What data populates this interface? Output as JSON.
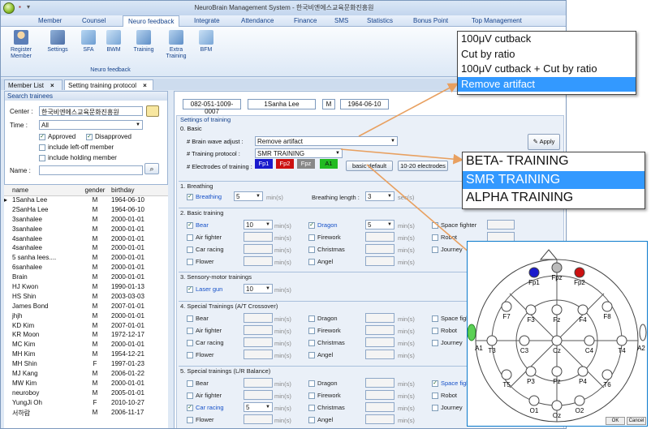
{
  "window": {
    "title": "NeuroBrain Management System - 한국비엔에스교육문화진흥원"
  },
  "menu": [
    "Member",
    "Counsel",
    "Neuro feedback",
    "Integrate",
    "Attendance",
    "Finance",
    "SMS",
    "Statistics",
    "Bonus Point",
    "Top Management"
  ],
  "ribbon": {
    "buttons": [
      "Register Member",
      "Settings",
      "SFA",
      "BWM",
      "Training",
      "Extra Training",
      "BFM"
    ],
    "group_label": "Neuro feedback"
  },
  "tabs": [
    {
      "label": "Member List"
    },
    {
      "label": "Setting training protocol"
    }
  ],
  "search": {
    "header": "Search trainees",
    "center_label": "Center :",
    "center_value": "한국비엔에스교육문화진흥원",
    "time_label": "Time :",
    "time_value": "All",
    "approved": "Approved",
    "disapproved": "Disapproved",
    "left_off": "include left-off member",
    "holding": "include holding member",
    "name_label": "Name :",
    "name_value": ""
  },
  "member_table": {
    "headers": [
      "name",
      "gender",
      "birthday"
    ],
    "rows": [
      [
        "1Sanha Lee",
        "M",
        "1964-06-10"
      ],
      [
        "2SanHa Lee",
        "M",
        "1964-06-10"
      ],
      [
        "3sanhalee",
        "M",
        "2000-01-01"
      ],
      [
        "3sanhalee",
        "M",
        "2000-01-01"
      ],
      [
        "4sanhalee",
        "M",
        "2000-01-01"
      ],
      [
        "4sanhalee",
        "M",
        "2000-01-01"
      ],
      [
        "5 sanha lees....",
        "M",
        "2000-01-01"
      ],
      [
        "6sanhalee",
        "M",
        "2000-01-01"
      ],
      [
        "Brain",
        "M",
        "2000-01-01"
      ],
      [
        "HJ Kwon",
        "M",
        "1990-01-13"
      ],
      [
        "HS Shin",
        "M",
        "2003-03-03"
      ],
      [
        "James Bond",
        "M",
        "2007-01-01"
      ],
      [
        "jhjh",
        "M",
        "2000-01-01"
      ],
      [
        "KD Kim",
        "M",
        "2007-01-01"
      ],
      [
        "KR Moon",
        "M",
        "1972-12-17"
      ],
      [
        "MC Kim",
        "M",
        "2000-01-01"
      ],
      [
        "MH Kim",
        "M",
        "1954-12-21"
      ],
      [
        "MH Shin",
        "F",
        "1997-01-23"
      ],
      [
        "MJ Kang",
        "M",
        "2006-01-22"
      ],
      [
        "MW Kim",
        "M",
        "2000-01-01"
      ],
      [
        "neuroboy",
        "M",
        "2005-01-01"
      ],
      [
        "YungJi Oh",
        "F",
        "2010-10-27"
      ],
      [
        "서하람",
        "M",
        "2006-11-17"
      ]
    ]
  },
  "member_info": {
    "phone": "082-051-1009-0007",
    "name": "1Sanha Lee",
    "gender": "M",
    "birthday": "1964-06-10"
  },
  "settings": {
    "header": "Settings of training",
    "basic_title": "0. Basic",
    "brain_wave_label": "# Brain wave adjust :",
    "brain_wave_value": "Remove artifact",
    "protocol_label": "# Training protocol :",
    "protocol_value": "SMR TRAINING",
    "electrodes_label": "# Electrodes of training :",
    "electrodes": [
      {
        "name": "Fp1",
        "color": "#1a1acc"
      },
      {
        "name": "Fp2",
        "color": "#cc1111"
      },
      {
        "name": "Fpz",
        "color": "#888888"
      },
      {
        "name": "A1",
        "color": "#22bb22"
      }
    ],
    "basic_default": "basic default",
    "ten_twenty": "10-20 electrodes",
    "apply": "Apply",
    "breathing_title": "1. Breathing",
    "breathing": "Breathing",
    "breathing_min": "5",
    "min_unit": "min(s)",
    "breathing_length_label": "Breathing length :",
    "breathing_length": "3",
    "sec_unit": "sec(s)",
    "basic_training_title": "2. Basic training",
    "bear": "Bear",
    "bear_min": "10",
    "dragon": "Dragon",
    "dragon_min": "5",
    "space_fighter": "Space fighter",
    "air_fighter": "Air fighter",
    "firework": "Firework",
    "robot": "Robot",
    "car_racing": "Car racing",
    "christmas": "Christmas",
    "journey": "Journey",
    "flower": "Flower",
    "angel": "Angel",
    "sensory_title": "3. Sensory-motor trainings",
    "laser_gun": "Laser gun",
    "laser_min": "10",
    "special_at_title": "4. Special Trainings (A/T Crossover)",
    "space_fight_short": "Space fight",
    "special_lr_title": "5. Special trainings (L/R Balance)",
    "car_racing_min": "5"
  },
  "popup_artifact": [
    "100μV cutback",
    "Cut by ratio",
    "100μV cutback + Cut by ratio",
    "Remove artifact"
  ],
  "popup_protocol": [
    "BETA- TRAINING",
    "SMR TRAINING",
    "ALPHA TRAINING"
  ],
  "eeg_map": {
    "electrodes": [
      "Fp1",
      "Fpz",
      "Fp2",
      "F7",
      "F3",
      "Fz",
      "F4",
      "F8",
      "A1",
      "T3",
      "C3",
      "Cz",
      "C4",
      "T4",
      "A2",
      "T5",
      "P3",
      "Pz",
      "P4",
      "T6",
      "O1",
      "Oz",
      "O2"
    ],
    "ok": "OK",
    "cancel": "Cancel"
  },
  "colors": {
    "accent": "#1550c8",
    "highlight": "#3399ff",
    "arrow": "#e8a060"
  }
}
